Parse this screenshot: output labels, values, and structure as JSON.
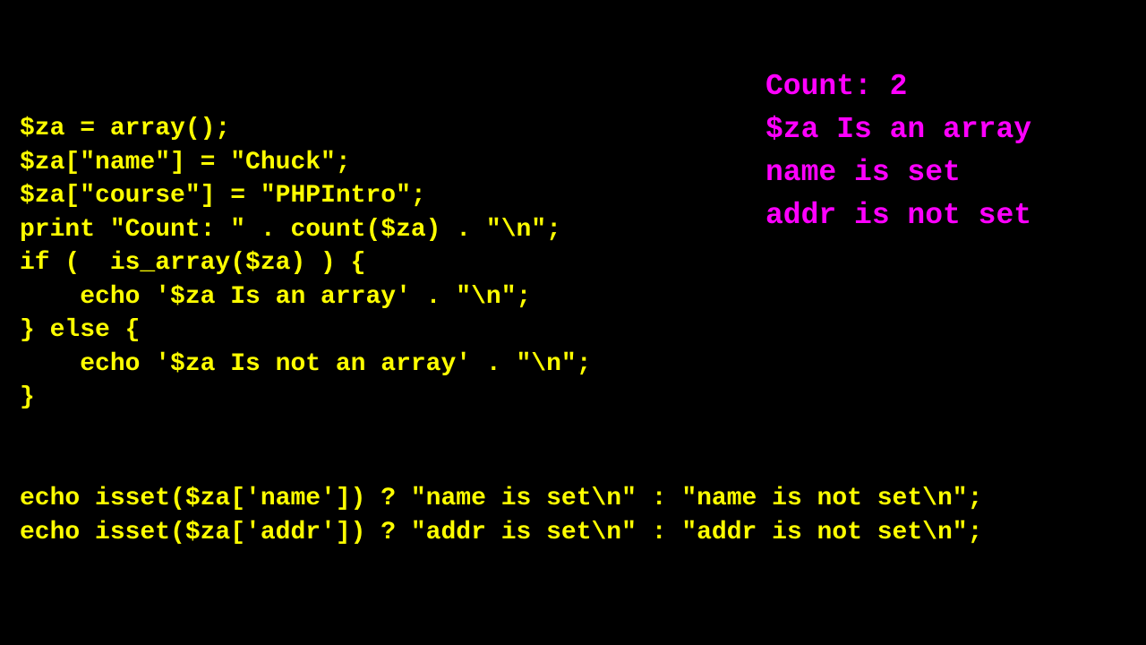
{
  "code": {
    "top": "$za = array();\n$za[\"name\"] = \"Chuck\";\n$za[\"course\"] = \"PHPIntro\";\nprint \"Count: \" . count($za) . \"\\n\";\nif (  is_array($za) ) {\n    echo '$za Is an array' . \"\\n\";\n} else {\n    echo '$za Is not an array' . \"\\n\";\n}",
    "bottom": "echo isset($za['name']) ? \"name is set\\n\" : \"name is not set\\n\";\necho isset($za['addr']) ? \"addr is set\\n\" : \"addr is not set\\n\";"
  },
  "output": "Count: 2\n$za Is an array\nname is set\naddr is not set"
}
